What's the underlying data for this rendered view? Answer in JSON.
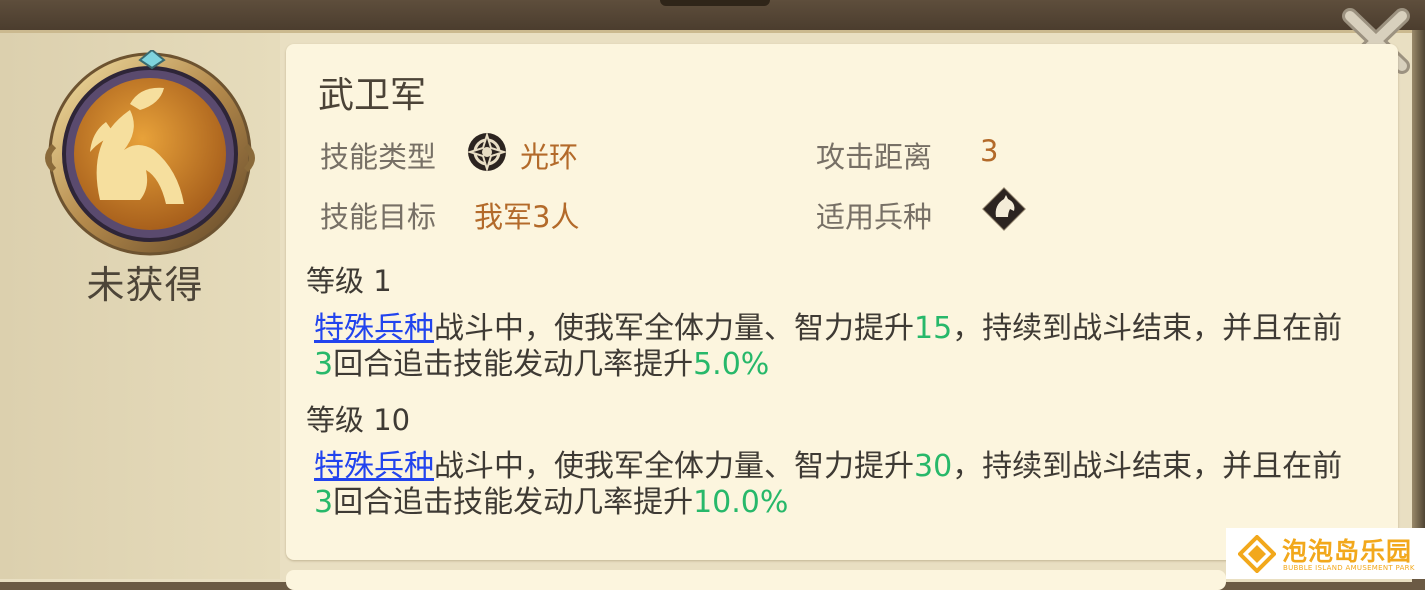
{
  "skill": {
    "name": "武卫军",
    "status": "未获得",
    "fields": {
      "type_label": "技能类型",
      "type_value": "光环",
      "range_label": "攻击距离",
      "range_value": "3",
      "target_label": "技能目标",
      "target_value": "我军3人",
      "unit_label": "适用兵种"
    },
    "levels": [
      {
        "label": "等级 1",
        "link": "特殊兵种",
        "text_a": "战斗中，使我军全体力量、智力提升",
        "num_a": "15",
        "text_b": "，持续到战斗结束，并且在前",
        "num_b": "3",
        "text_c": "回合追击技能发动几率提升",
        "num_c": "5.0%"
      },
      {
        "label": "等级 10",
        "link": "特殊兵种",
        "text_a": "战斗中，使我军全体力量、智力提升",
        "num_a": "30",
        "text_b": "，持续到战斗结束，并且在前",
        "num_b": "3",
        "text_c": "回合追击技能发动几率提升",
        "num_c": "10.0%"
      }
    ]
  },
  "icons": {
    "medal": "horse-medal-icon",
    "type": "aura-ring-icon",
    "unit": "horse-head-icon",
    "close": "close-icon"
  },
  "colors": {
    "value": "#b36a2a",
    "number": "#27b86a",
    "link": "#2244ee"
  },
  "watermark": {
    "title": "泡泡岛乐园",
    "subtitle": "BUBBLE ISLAND AMUSEMENT PARK"
  }
}
